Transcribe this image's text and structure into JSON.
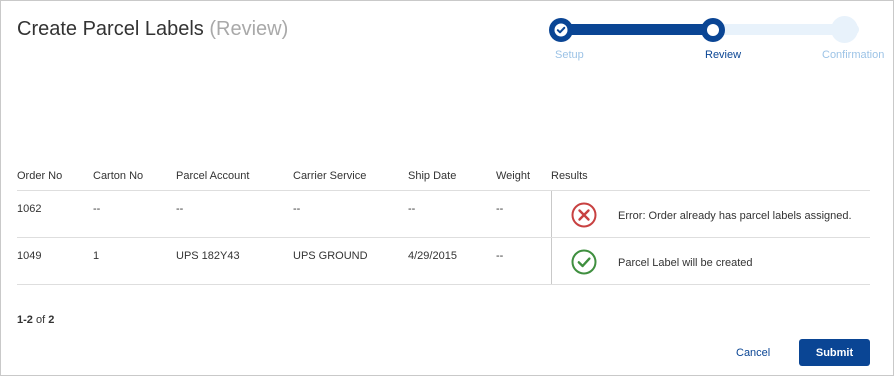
{
  "dialog": {
    "title": "Create Parcel Labels",
    "title_sub": "(Review)"
  },
  "stepper": {
    "steps": [
      {
        "label": "Setup",
        "state": "complete"
      },
      {
        "label": "Review",
        "state": "current"
      },
      {
        "label": "Confirmation",
        "state": "upcoming"
      }
    ]
  },
  "table": {
    "columns": [
      "Order No",
      "Carton No",
      "Parcel Account",
      "Carrier Service",
      "Ship Date",
      "Weight",
      "Results"
    ],
    "rows": [
      {
        "order_no": "1062",
        "carton_no": "--",
        "parcel_account": "--",
        "carrier_service": "--",
        "ship_date": "--",
        "weight": "--",
        "result_icon": "error-circle-x-icon",
        "result_text": "Error: Order already has parcel labels assigned."
      },
      {
        "order_no": "1049",
        "carton_no": "1",
        "parcel_account": "UPS 182Y43",
        "carrier_service": "UPS GROUND",
        "ship_date": "4/29/2015",
        "weight": "--",
        "result_icon": "success-circle-check-icon",
        "result_text": "Parcel Label will be created"
      }
    ]
  },
  "pager": {
    "range": "1-2",
    "of_label": "of",
    "total": "2"
  },
  "actions": {
    "cancel_label": "Cancel",
    "submit_label": "Submit"
  },
  "colors": {
    "primary": "#0a4594",
    "stepper_light": "#e8f2fb",
    "step_inactive_text": "#9cc3e6",
    "error": "#c84141",
    "success": "#3f8f3f"
  }
}
